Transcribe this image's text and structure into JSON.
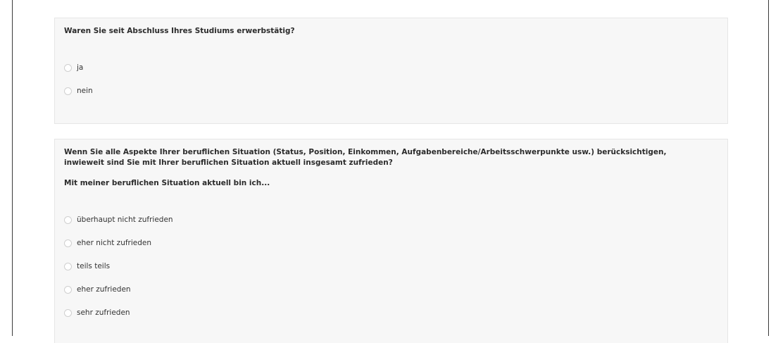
{
  "q1": {
    "text": "Waren Sie seit Abschluss Ihres Studiums erwerbstätig?",
    "options": [
      "ja",
      "nein"
    ]
  },
  "q2": {
    "text": "Wenn Sie alle Aspekte Ihrer beruflichen Situation (Status, Position, Einkommen, Aufgabenbereiche/Arbeitsschwerpunkte usw.) berücksichtigen, inwieweit sind Sie mit Ihrer beruflichen Situation aktuell insgesamt zufrieden?",
    "subtext": "Mit meiner beruflichen Situation aktuell bin ich...",
    "options": [
      "überhaupt nicht zufrieden",
      "eher nicht zufrieden",
      "teils teils",
      "eher zufrieden",
      "sehr zufrieden"
    ]
  }
}
